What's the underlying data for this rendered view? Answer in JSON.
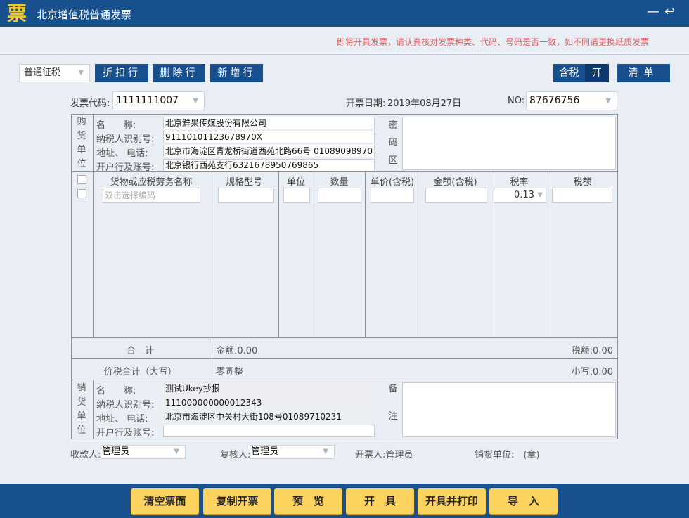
{
  "window": {
    "title": "北京增值税普通发票",
    "logo": "票",
    "minimize": "—",
    "back": "↩"
  },
  "notice": "即将开具发票，请认真核对发票种类、代码、号码是否一致，如不同请更换纸质发票",
  "toolbar": {
    "tax_type": "普通征税",
    "discount_row": "折扣行",
    "delete_row": "删除行",
    "add_row": "新增行",
    "tax_incl": "含税",
    "tax_incl_state": "开",
    "list": "清单"
  },
  "header": {
    "code_label": "发票代码:",
    "code": "1111111007",
    "date_label": "开票日期:",
    "date": "2019年08月27日",
    "no_label": "NO:",
    "no": "87676756"
  },
  "buyer": {
    "section": [
      "购",
      "货",
      "单",
      "位"
    ],
    "name_label": "名　　称:",
    "name": "北京鲜果传媒股份有限公司",
    "tax_id_label": "纳税人识别号:",
    "tax_id": "91110101123678970X",
    "addr_label": "地址、 电话:",
    "addr": "北京市海淀区青龙桥街道西苑北路66号 01089098970",
    "bank_label": "开户行及账号:",
    "bank": "北京银行西苑支行6321678950769865",
    "cipher": [
      "密",
      "码",
      "区"
    ]
  },
  "items": {
    "columns": [
      "货物或应税劳务名称",
      "规格型号",
      "单位",
      "数量",
      "单价(含税)",
      "金额(含税)",
      "税率",
      "税额"
    ],
    "name_placeholder": "双击选择编码",
    "tax_rate": "0.13"
  },
  "totals": {
    "sum_label": "合　计",
    "amount": "金额:0.00",
    "tax": "税额:0.00",
    "total_label": "价税合计（大写）",
    "total_words": "零圆整",
    "total_small": "小写:0.00"
  },
  "seller": {
    "section": [
      "销",
      "货",
      "单",
      "位"
    ],
    "name_label": "名　　称:",
    "name": "测试Ukey抄报",
    "tax_id_label": "纳税人识别号:",
    "tax_id": "111000000000012343",
    "addr_label": "地址、 电话:",
    "addr": "北京市海淀区中关村大街108号01089710231",
    "bank_label": "开户行及账号:",
    "bank": "",
    "remark": [
      "备",
      "注"
    ]
  },
  "signers": {
    "payee_label": "收款人:",
    "payee": "管理员",
    "reviewer_label": "复核人:",
    "reviewer": "管理员",
    "issuer": "开票人:管理员",
    "seal": "销货单位:　(章)"
  },
  "footer": {
    "clear": "清空票面",
    "copy": "复制开票",
    "preview": "预　览",
    "issue": "开　具",
    "issue_print": "开具并打印",
    "import": "导　入"
  }
}
